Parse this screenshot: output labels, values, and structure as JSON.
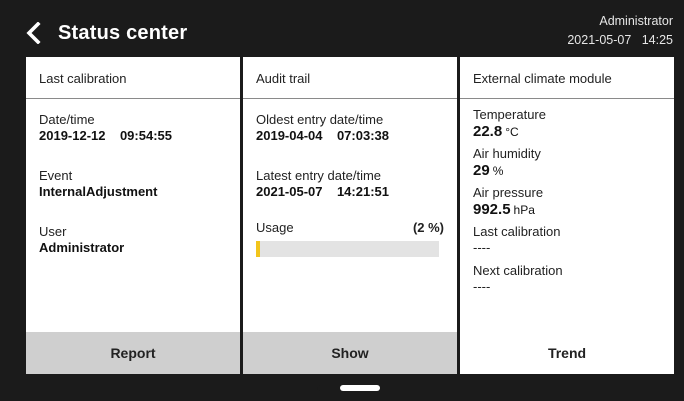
{
  "header": {
    "title": "Status center",
    "user": "Administrator",
    "datetime": "2021-05-07   14:25"
  },
  "calibration": {
    "heading": "Last calibration",
    "date_label": "Date/time",
    "date_value": "2019-12-12    09:54:55",
    "event_label": "Event",
    "event_value": "InternalAdjustment",
    "user_label": "User",
    "user_value": "Administrator",
    "button": "Report"
  },
  "audit": {
    "heading": "Audit trail",
    "oldest_label": "Oldest entry date/time",
    "oldest_value": "2019-04-04    07:03:38",
    "latest_label": "Latest entry date/time",
    "latest_value": "2021-05-07    14:21:51",
    "usage_label": "Usage",
    "usage_pct": "(2 %)",
    "usage_fraction": 0.02,
    "button": "Show"
  },
  "climate": {
    "heading": "External climate module",
    "temp_label": "Temperature",
    "temp_value": "22.8",
    "temp_unit": "°C",
    "humidity_label": "Air humidity",
    "humidity_value": "29",
    "humidity_unit": "%",
    "pressure_label": "Air pressure",
    "pressure_value": "992.5",
    "pressure_unit": "hPa",
    "last_cal_label": "Last calibration",
    "last_cal_value": "----",
    "next_cal_label": "Next calibration",
    "next_cal_value": "----",
    "button": "Trend"
  },
  "colors": {
    "background": "#1b1b1b",
    "panel": "#ffffff",
    "button_grey": "#cfcfcf",
    "usage_fill": "#f2c51b"
  },
  "icons": {
    "back": "chevron-left-icon"
  },
  "pager": {
    "pages": 2,
    "active": 2
  }
}
